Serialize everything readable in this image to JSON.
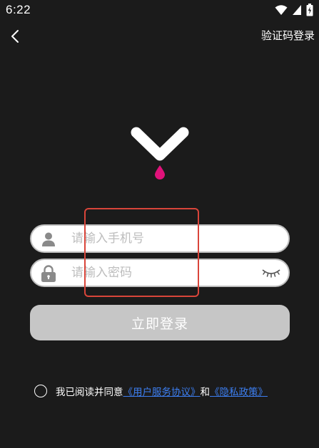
{
  "status_bar": {
    "time": "6:22",
    "icons": [
      "wifi-icon",
      "cell-signal-icon",
      "battery-charging-icon"
    ]
  },
  "nav": {
    "back_icon": "chevron-left-icon",
    "sms_login_label": "验证码登录"
  },
  "logo": {
    "icon": "app-logo-icon",
    "colors": {
      "chevron": "#ffffff",
      "drop": "#e0127a"
    }
  },
  "form": {
    "phone": {
      "placeholder": "请输入手机号",
      "value": "",
      "icon": "user-icon"
    },
    "password": {
      "placeholder": "请输入密码",
      "value": "",
      "icon": "lock-icon",
      "toggle_icon": "eye-closed-icon"
    },
    "login_label": "立即登录"
  },
  "agreement": {
    "prefix": "我已阅读并同意",
    "user_agreement": "《用户服务协议》",
    "connector": "和",
    "privacy_policy": "《隐私政策》",
    "checked": false
  },
  "colors": {
    "background": "#1b1b1b",
    "button": "#c6c6c6",
    "link": "#3d7ff2",
    "highlight": "#d9453a"
  }
}
